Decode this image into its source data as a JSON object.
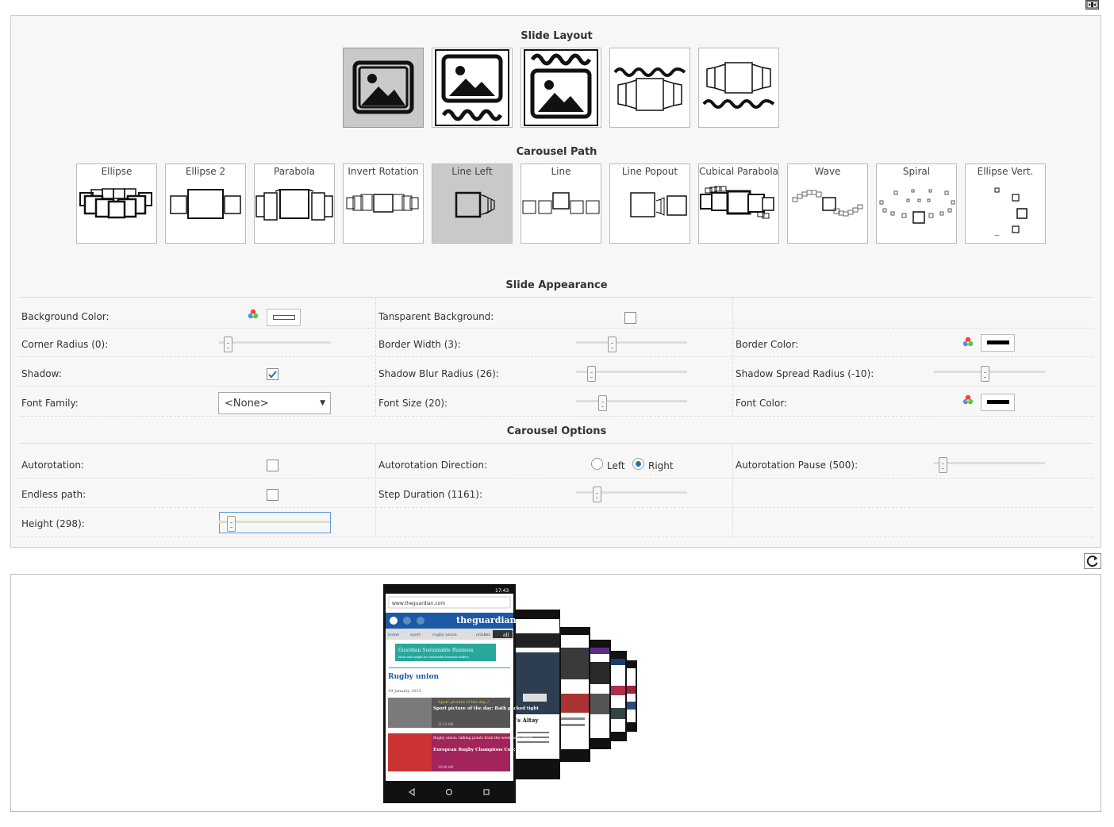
{
  "slide_layout": {
    "title": "Slide Layout",
    "options": [
      "image-only",
      "image-caption-below",
      "image-caption-above",
      "caption-above-carousel",
      "caption-below-carousel"
    ]
  },
  "carousel_path": {
    "title": "Carousel Path",
    "options": [
      "Ellipse",
      "Ellipse 2",
      "Parabola",
      "Invert Rotation",
      "Line Left",
      "Line",
      "Line Popout",
      "Cubical Parabola",
      "Wave",
      "Spiral",
      "Ellipse Vert."
    ],
    "selected": "Line Left"
  },
  "slide_appearance": {
    "title": "Slide Appearance",
    "background_color_label": "Background Color:",
    "transparent_background_label": "Tansparent Background:",
    "corner_radius_label": "Corner Radius (0):",
    "corner_radius_value": 0,
    "border_width_label": "Border Width (3):",
    "border_width_value": 3,
    "border_color_label": "Border Color:",
    "shadow_label": "Shadow:",
    "shadow_checked": true,
    "shadow_blur_label": "Shadow Blur Radius (26):",
    "shadow_blur_value": 26,
    "shadow_spread_label": "Shadow Spread Radius (-10):",
    "shadow_spread_value": -10,
    "font_family_label": "Font Family:",
    "font_family_value": "<None>",
    "font_size_label": "Font Size (20):",
    "font_size_value": 20,
    "font_color_label": "Font Color:",
    "colors": {
      "background": "#ffffff",
      "border": "#000000",
      "font": "#000000"
    }
  },
  "carousel_options": {
    "title": "Carousel Options",
    "autorotation_label": "Autorotation:",
    "autorotation_checked": false,
    "autorotation_direction_label": "Autorotation Direction:",
    "direction_left": "Left",
    "direction_right": "Right",
    "direction_selected": "Right",
    "autorotation_pause_label": "Autorotation Pause (500):",
    "autorotation_pause_value": 500,
    "endless_path_label": "Endless path:",
    "endless_path_checked": false,
    "step_duration_label": "Step Duration (1161):",
    "step_duration_value": 1161,
    "height_label": "Height (298):",
    "height_value": 298
  },
  "icons": {
    "maximize": "maximize-icon",
    "reload": "reload-icon",
    "color_picker": "color-wheel-icon"
  },
  "preview": {
    "url": "www.theguardian.com",
    "time": "17:43",
    "brand": "theguardian",
    "crumbs": [
      "home",
      "sport",
      "rugby union"
    ],
    "crumb_extra": "cricket",
    "crumb_all": "all",
    "banner": "Guardian Sustainable Business",
    "banner_sub": "Ideas and insight for sustainable business leaders",
    "section": "Rugby union",
    "date": "19 January 2015",
    "story1_tag": "Sport picture of the day /",
    "story1_title": "Sport picture of the day: Bath packed tight",
    "story1_meta": "11:14 AM",
    "story2_tag": "Rugby union: talking points from the weekend's action",
    "story2_title": "European Rugby Champions Cup: six talking points",
    "story2_meta": "10:00 AM",
    "back_phone_text1": "'s Altay",
    "back_phone_text2": "an obscure view the last usand-year-old"
  }
}
